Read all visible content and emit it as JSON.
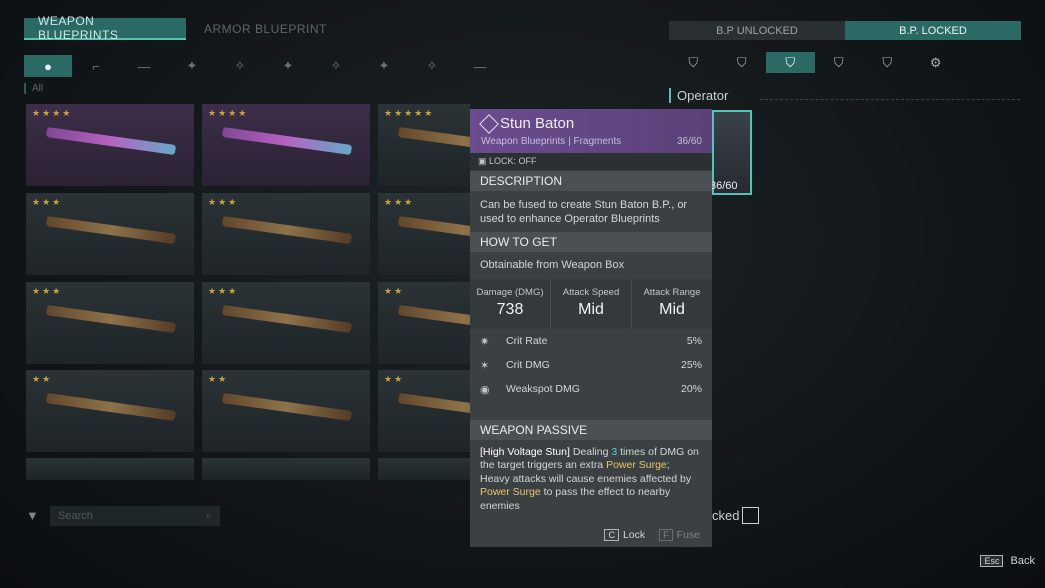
{
  "tabs": {
    "weapon": "WEAPON BLUEPRINTS",
    "armor": "ARMOR BLUEPRINT"
  },
  "filter_all": "All",
  "categories": [
    "●",
    "⌐",
    "—",
    "✦",
    "✧",
    "✦",
    "✧",
    "✦",
    "✧",
    "—"
  ],
  "grid": {
    "cards": [
      {
        "stars": "★★★★",
        "purple": true
      },
      {
        "stars": "★★★★",
        "purple": true
      },
      {
        "stars": "★★★★★",
        "purple": false
      },
      {
        "stars": "★★★",
        "purple": false
      },
      {
        "stars": "★★★",
        "purple": false
      },
      {
        "stars": "★★★",
        "purple": false
      },
      {
        "stars": "★★★",
        "purple": false
      },
      {
        "stars": "★★★",
        "purple": false
      },
      {
        "stars": "★★",
        "purple": false
      },
      {
        "stars": "★★",
        "purple": false
      },
      {
        "stars": "★★",
        "purple": false
      },
      {
        "stars": "★★",
        "purple": false
      }
    ]
  },
  "search": {
    "placeholder": "Search"
  },
  "bp_toggle": {
    "unlocked": "B.P UNLOCKED",
    "locked": "B.P. LOCKED"
  },
  "operator": {
    "label": "Operator",
    "count": "36/60"
  },
  "locked_label": "cked",
  "tooltip": {
    "title": "Stun Baton",
    "subtitle": "Weapon Blueprints | Fragments",
    "count": "36/60",
    "lock_state": "LOCK: OFF",
    "description_header": "DESCRIPTION",
    "description": "Can be fused to create Stun Baton B.P., or used to enhance Operator Blueprints",
    "how_header": "HOW TO GET",
    "how": "Obtainable from Weapon Box",
    "stats": [
      {
        "label": "Damage (DMG)",
        "value": "738"
      },
      {
        "label": "Attack Speed",
        "value": "Mid"
      },
      {
        "label": "Attack Range",
        "value": "Mid"
      }
    ],
    "rows": [
      {
        "name": "Crit Rate",
        "value": "5%"
      },
      {
        "name": "Crit DMG",
        "value": "25%"
      },
      {
        "name": "Weakspot DMG",
        "value": "20%"
      }
    ],
    "passive_header": "WEAPON PASSIVE",
    "passive": {
      "name": "[High Voltage Stun]",
      "t1": " Dealing ",
      "n": "3",
      "t2": " times of DMG on the target triggers an extra ",
      "k1": "Power Surge",
      "t3": "; Heavy attacks will cause enemies affected by ",
      "k2": "Power Surge",
      "t4": " to pass the effect to nearby enemies"
    },
    "lock_key": "C",
    "lock_label": "Lock",
    "fuse_key": "F",
    "fuse_label": "Fuse"
  },
  "esc": {
    "key": "Esc",
    "label": "Back"
  }
}
